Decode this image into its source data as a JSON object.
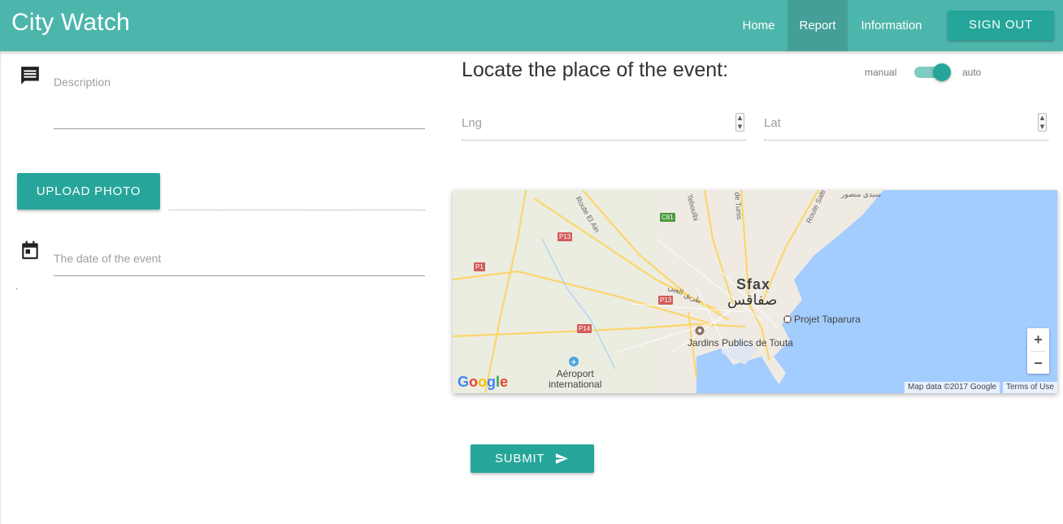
{
  "header": {
    "brand": "City Watch",
    "nav": [
      {
        "label": "Home"
      },
      {
        "label": "Report",
        "active": true
      },
      {
        "label": "Information"
      }
    ],
    "signout_label": "SIGN OUT"
  },
  "form": {
    "description_placeholder": "Description",
    "upload_label": "UPLOAD PHOTO",
    "date_placeholder": "The date of the event",
    "submit_label": "SUBMIT"
  },
  "locate": {
    "title": "Locate the place of the event:",
    "toggle": {
      "left_label": "manual",
      "right_label": "auto",
      "state": "auto"
    },
    "lng_placeholder": "Lng",
    "lat_placeholder": "Lat"
  },
  "map": {
    "city": "Sfax",
    "city_arabic": "صفاقس",
    "poi_1": "Projet Taparura",
    "poi_2": "Jardins Publics de Touta",
    "airport_line1": "Aéroport",
    "airport_line2": "international",
    "road_labels": [
      "P13",
      "P1",
      "P13",
      "P14",
      "C81"
    ],
    "street_labels": [
      "Route El Ain",
      "Teboulbi",
      "de Tunis",
      "Route Saltn",
      "طريق العين",
      "سيدي منصور"
    ],
    "attribution": "Map data ©2017 Google",
    "terms": "Terms of Use",
    "zoom_in": "+",
    "zoom_out": "−",
    "logo": "Google",
    "colors": {
      "water": "#a3ccff",
      "land": "#efebe3",
      "road": "#fbd66b"
    }
  },
  "colors": {
    "primary": "#4db6ac",
    "button": "#26a69a"
  }
}
